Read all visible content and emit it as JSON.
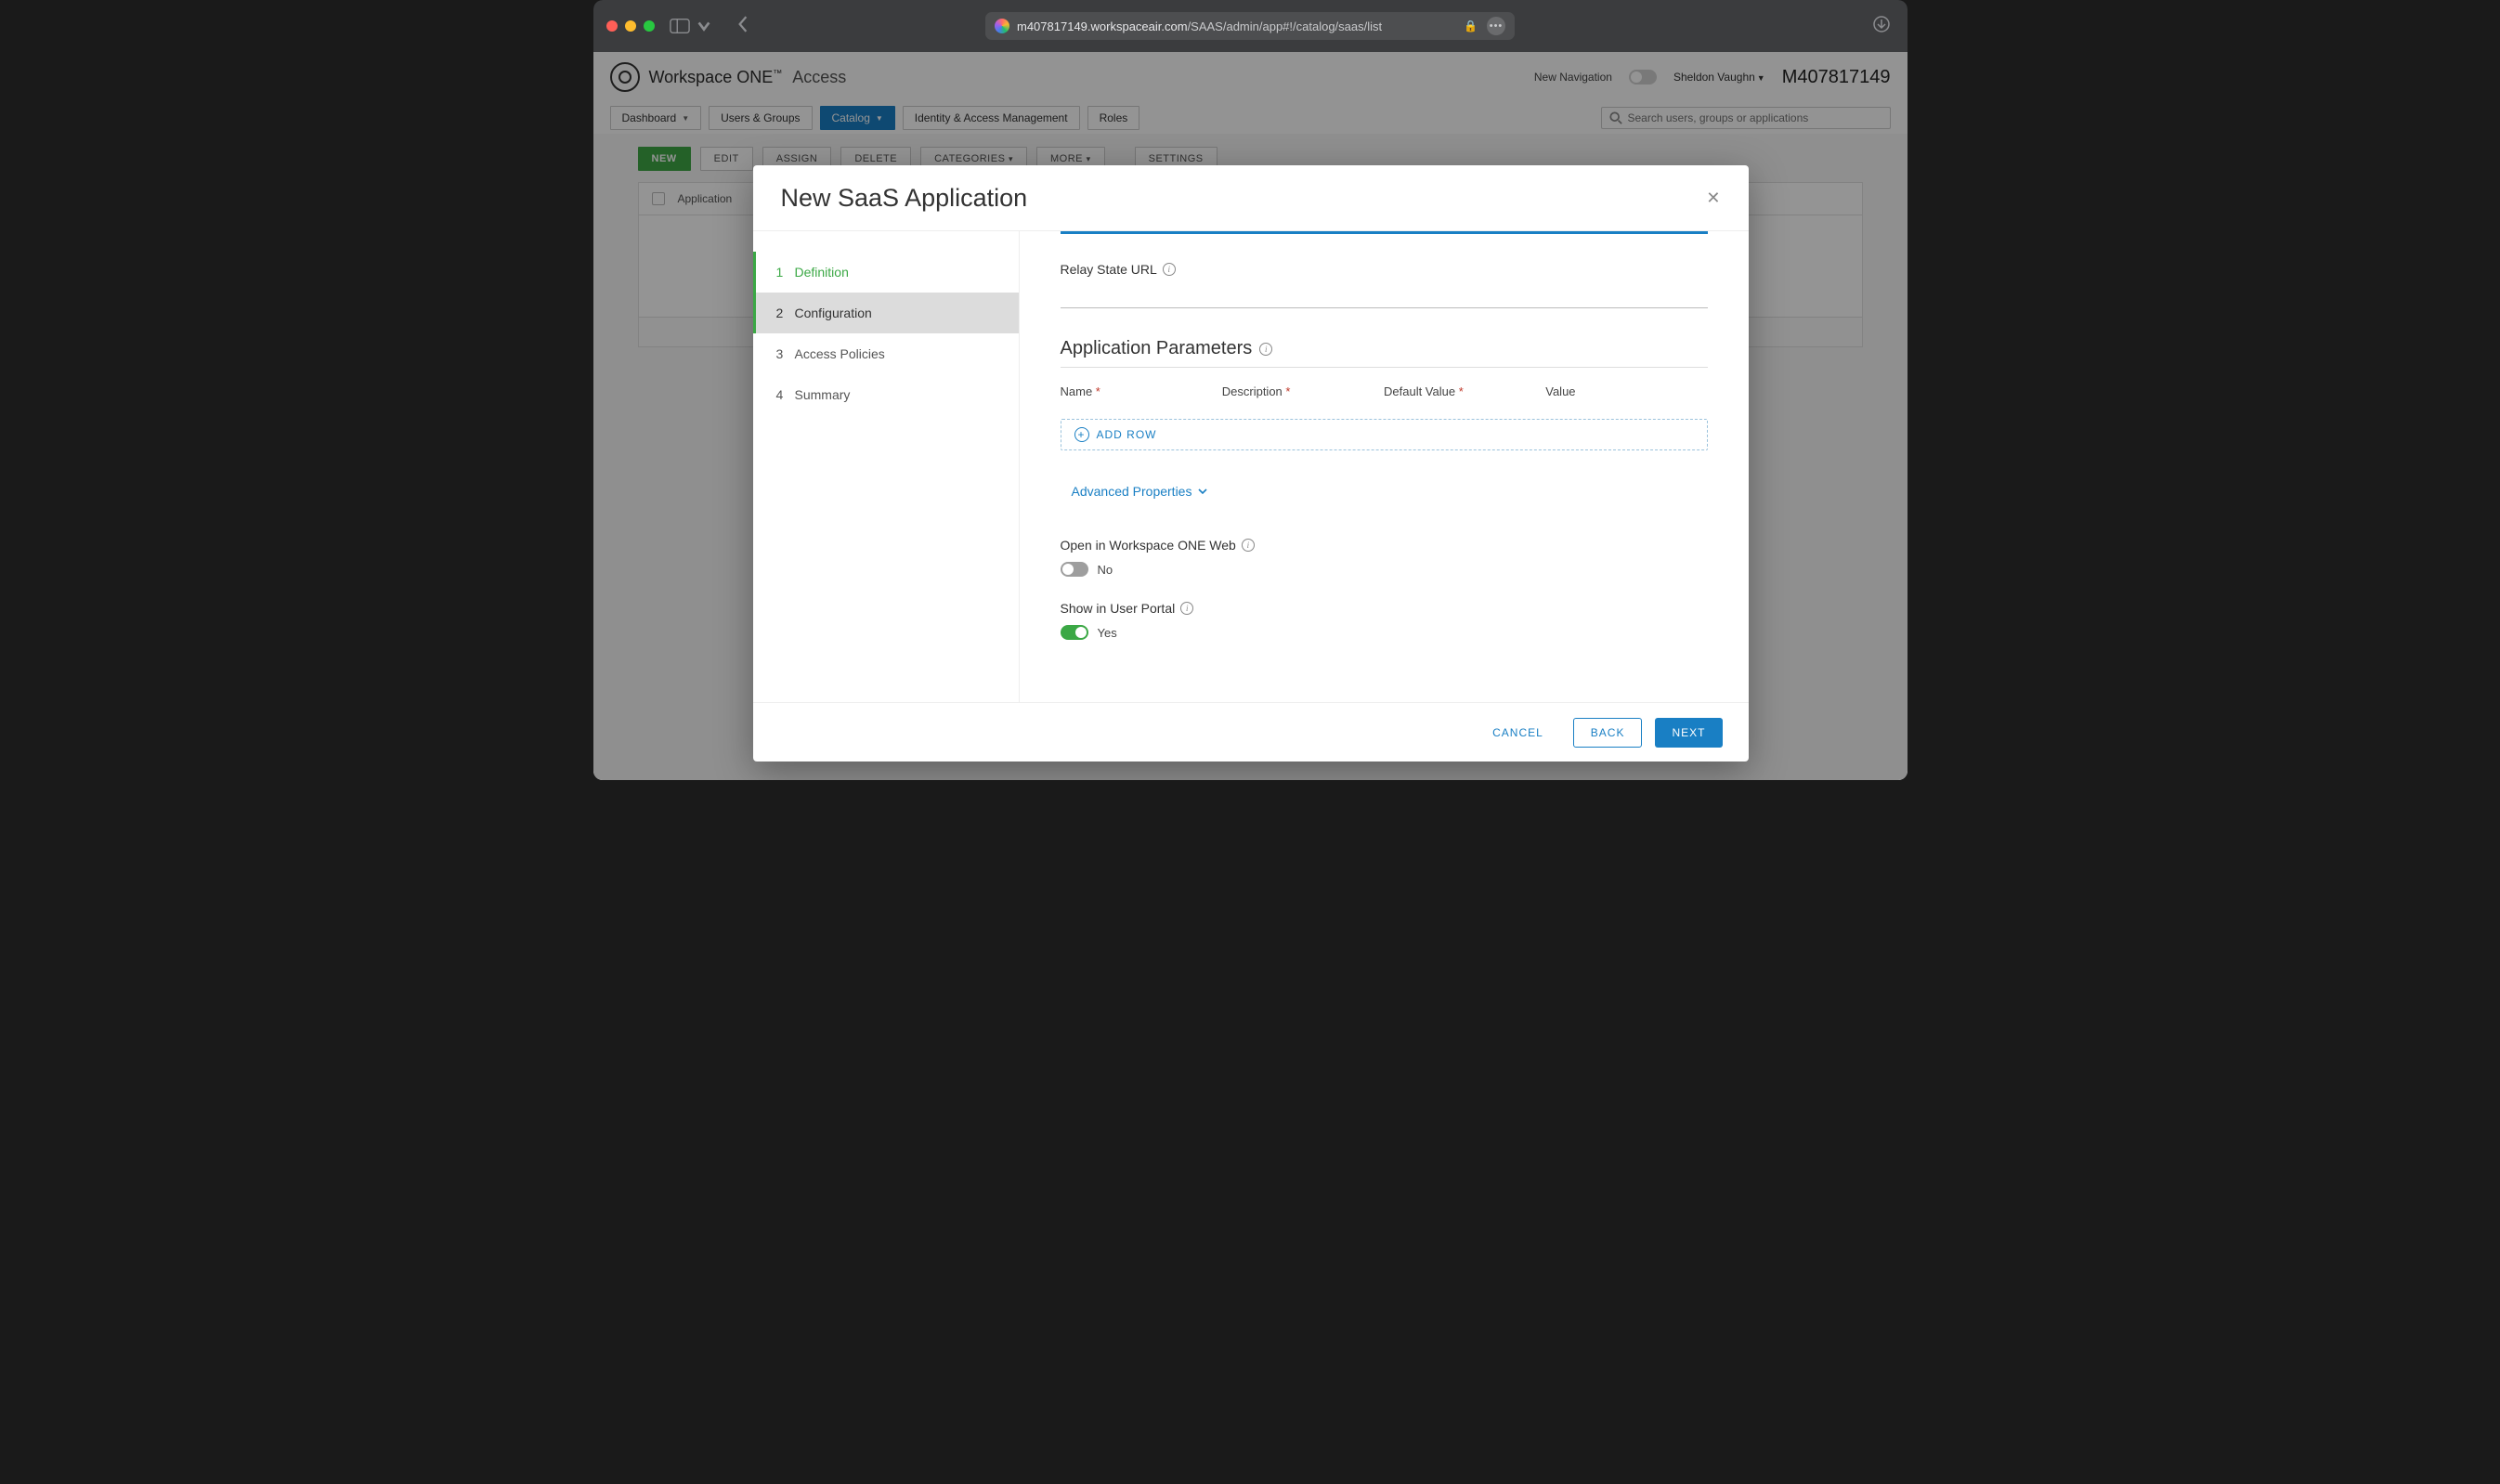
{
  "browser": {
    "url_domain": "m407817149.workspaceair.com",
    "url_path": "/SAAS/admin/app#!/catalog/saas/list"
  },
  "app": {
    "brand_main": "Workspace ONE",
    "brand_sub": "Access",
    "new_nav_label": "New Navigation",
    "user_name": "Sheldon Vaughn",
    "tenant": "M407817149",
    "search_placeholder": "Search users, groups or applications"
  },
  "nav": {
    "dashboard": "Dashboard",
    "users_groups": "Users & Groups",
    "catalog": "Catalog",
    "iam": "Identity & Access Management",
    "roles": "Roles"
  },
  "toolbar": {
    "new": "NEW",
    "edit": "EDIT",
    "assign": "ASSIGN",
    "delete": "DELETE",
    "categories": "CATEGORIES",
    "more": "MORE",
    "settings": "SETTINGS",
    "col_app": "Application"
  },
  "modal": {
    "title": "New SaaS Application",
    "steps": {
      "s1": "Definition",
      "s2": "Configuration",
      "s3": "Access Policies",
      "s4": "Summary"
    },
    "relay_label": "Relay State URL",
    "params_title": "Application Parameters",
    "col_name": "Name",
    "col_desc": "Description",
    "col_default": "Default Value",
    "col_value": "Value",
    "add_row": "ADD ROW",
    "advanced": "Advanced Properties",
    "open_web_label": "Open in Workspace ONE Web",
    "open_web_value": "No",
    "show_portal_label": "Show in User Portal",
    "show_portal_value": "Yes",
    "cancel": "CANCEL",
    "back": "BACK",
    "next": "NEXT"
  }
}
